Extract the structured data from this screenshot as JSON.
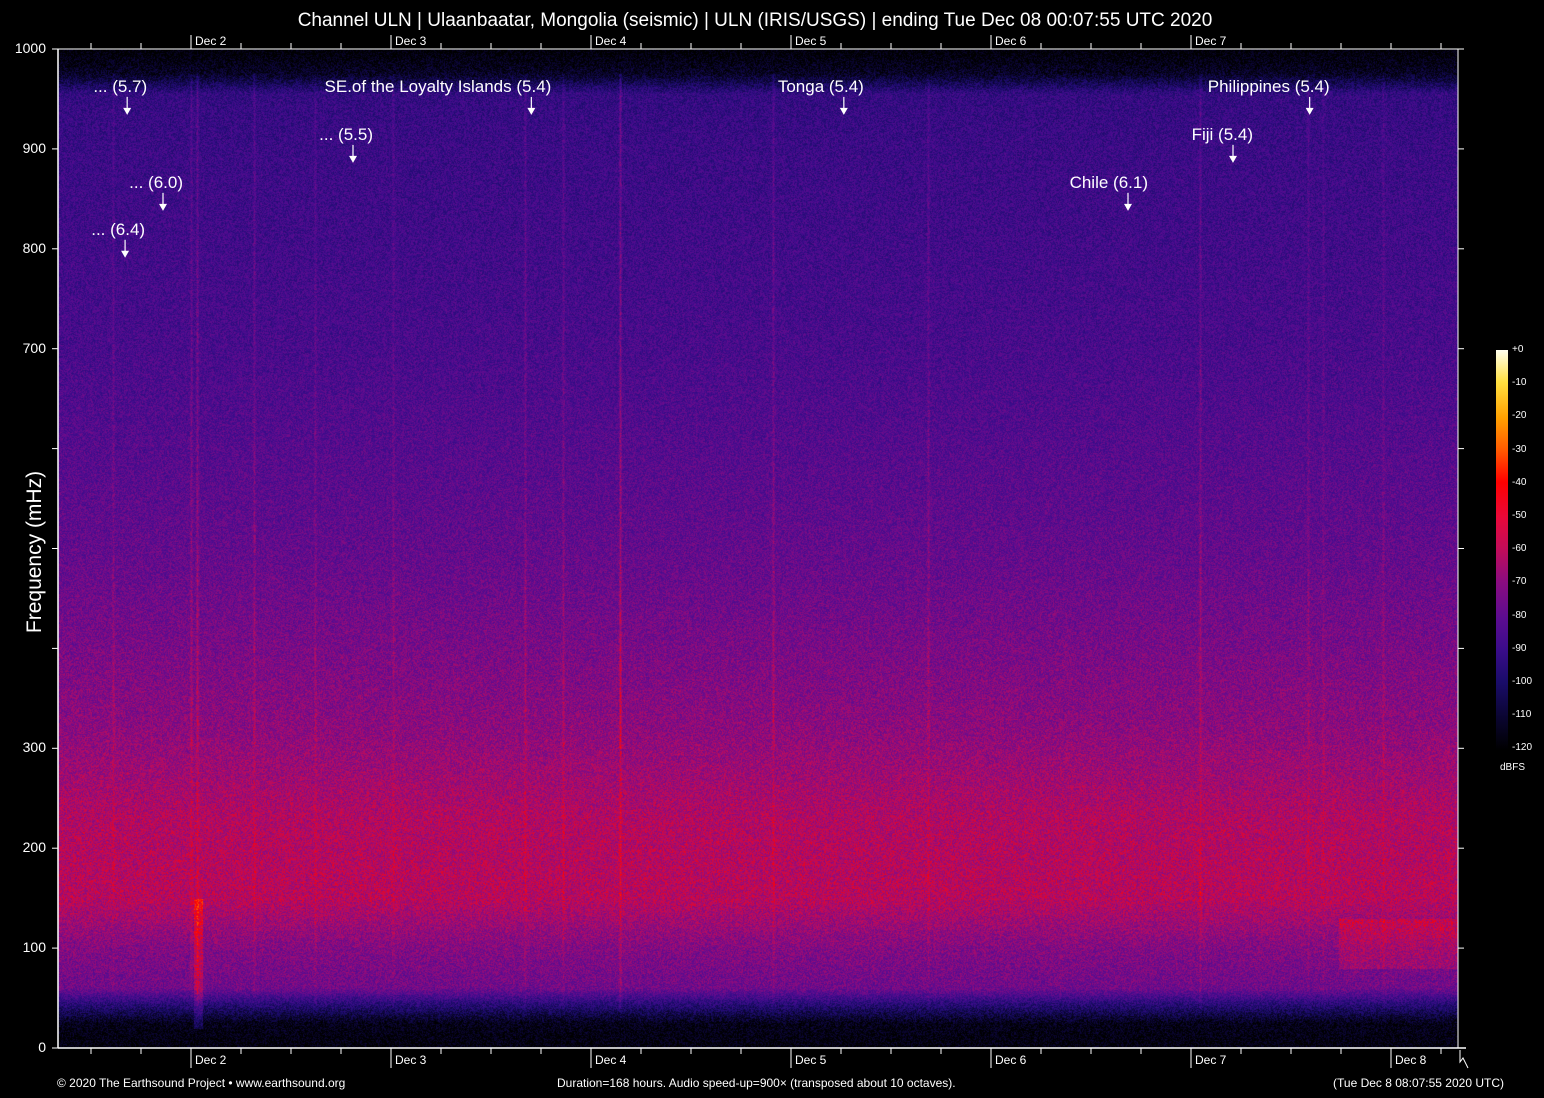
{
  "title": "Channel ULN | Ulaanbaatar, Mongolia (seismic) | ULN (IRIS/USGS) | ending Tue Dec 08 00:07:55 UTC 2020",
  "chart_data": {
    "type": "heatmap",
    "title": "Channel ULN | Ulaanbaatar, Mongolia (seismic) | ULN (IRIS/USGS) | ending Tue Dec 08 00:07:55 UTC 2020",
    "ylabel": "Frequency (mHz)",
    "ylim": [
      0,
      1000
    ],
    "y_ticks": [
      "0",
      "100",
      "200",
      "300",
      "",
      "",
      "",
      "700",
      "800",
      "900",
      "1000"
    ],
    "x_range": [
      "Dec 1 08:07",
      "Dec 8 08:07"
    ],
    "x_ticks_bottom": [
      "Dec 2",
      "Dec 3",
      "Dec 4",
      "Dec 5",
      "Dec 6",
      "Dec 7",
      "Dec 8"
    ],
    "x_ticks_top": [
      "Dec 2",
      "Dec 3",
      "Dec 4",
      "Dec 5",
      "Dec 6",
      "Dec 7"
    ],
    "colorbar": {
      "label": "dBFS",
      "range": [
        -120,
        0
      ],
      "ticks": [
        "+0",
        "-10",
        "-20",
        "-30",
        "-40",
        "-50",
        "-60",
        "-70",
        "-80",
        "-90",
        "-100",
        "-110",
        "-120"
      ]
    },
    "annotations": [
      {
        "label": "... (5.7)",
        "time": "Dec 1 16:25",
        "freq": 934
      },
      {
        "label": "... (6.0)",
        "time": "Dec 1 20:43",
        "freq": 838
      },
      {
        "label": "... (6.4)",
        "time": "Dec 1 16:10",
        "freq": 791
      },
      {
        "label": "... (5.5)",
        "time": "Dec 2 19:31",
        "freq": 886
      },
      {
        "label": "SE.of the Loyalty Islands (5.4)",
        "time": "Dec 3 16:55",
        "freq": 934
      },
      {
        "label": "Tonga (5.4)",
        "time": "Dec 5 06:25",
        "freq": 934
      },
      {
        "label": "Chile (6.1)",
        "time": "Dec 6 16:31",
        "freq": 838
      },
      {
        "label": "Fiji (5.4)",
        "time": "Dec 7 05:07",
        "freq": 886
      },
      {
        "label": "Philippines (5.4)",
        "time": "Dec 7 14:19",
        "freq": 934
      }
    ]
  },
  "footer": {
    "copyright": "© 2020 The Earthsound Project • www.earthsound.org",
    "info": "Duration=168 hours. Audio speed-up=900× (transposed about 10 octaves).",
    "timestamp": "(Tue Dec  8 08:07:55 2020 UTC)"
  }
}
